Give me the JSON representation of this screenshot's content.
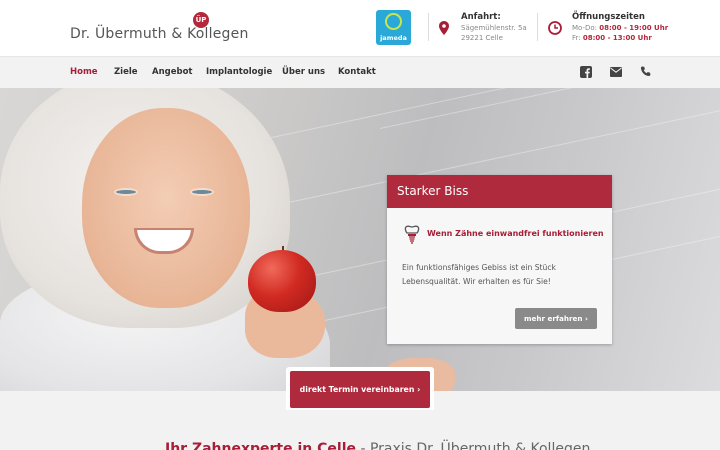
{
  "header": {
    "logo_text": "Dr. Übermuth & Kollegen",
    "logo_mark": "ÜP",
    "jameda_label": "jameda",
    "address": {
      "title": "Anfahrt:",
      "line1": "Sägemühlenstr. 5a",
      "line2": "29221 Celle",
      "icon": "map-pin-icon"
    },
    "hours": {
      "title": "Öffnungszeiten",
      "row1_label": "Mo-Do:",
      "row1_value": "08:00 - 19:00 Uhr",
      "row2_label": "Fr:",
      "row2_value": "08:00 - 13:00 Uhr",
      "icon": "clock-icon"
    }
  },
  "nav": {
    "items": [
      {
        "label": "Home",
        "active": true
      },
      {
        "label": "Ziele",
        "active": false
      },
      {
        "label": "Angebot",
        "active": false
      },
      {
        "label": "Implantologie",
        "active": false
      },
      {
        "label": "Über uns",
        "active": false
      },
      {
        "label": "Kontakt",
        "active": false
      }
    ],
    "social": [
      "facebook-icon",
      "mail-icon",
      "phone-icon"
    ]
  },
  "hero_card": {
    "title": "Starker Biss",
    "subtitle": "Wenn Zähne einwandfrei funktionieren",
    "text": "Ein funktionsfähiges Gebiss ist ein Stück Lebensqualität. Wir erhalten es für Sie!",
    "button": "mehr erfahren ›"
  },
  "cta": {
    "label": "direkt Termin vereinbaren ›"
  },
  "section": {
    "title_accent": "Ihr Zahnexperte in Celle",
    "title_rest": " - Praxis Dr. Übermuth & Kollegen"
  },
  "colors": {
    "brand": "#b02a3d",
    "nav_bg": "#f2f2f2",
    "jameda": "#2aa9d8"
  }
}
